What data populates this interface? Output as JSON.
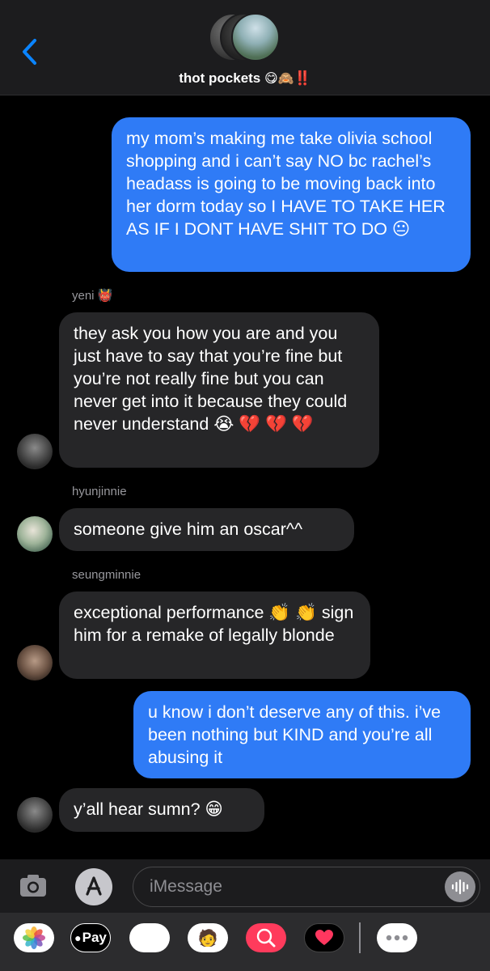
{
  "header": {
    "title": "thot pockets",
    "title_emojis": "😋🙈",
    "title_bang": "‼️"
  },
  "messages": [
    {
      "id": 1,
      "direction": "outgoing",
      "text": "my mom’s making me take olivia school shopping and i can’t say NO bc rachel’s headass is going to be moving back into her dorm today so I HAVE TO TAKE HER AS IF I DONT HAVE SHIT TO DO 😐"
    },
    {
      "id": 2,
      "direction": "incoming",
      "sender": "yeni 👹",
      "text": "they ask you how you are and you just have to say that you’re fine but you’re not really fine but you can never get into it because they could never understand 😭 💔 💔 💔"
    },
    {
      "id": 3,
      "direction": "incoming",
      "sender": "hyunjinnie",
      "text": "someone give him an oscar^^"
    },
    {
      "id": 4,
      "direction": "incoming",
      "sender": "seungminnie",
      "text": "exceptional performance 👏 👏 sign him for a remake of legally blonde"
    },
    {
      "id": 5,
      "direction": "outgoing",
      "text": "u know i don’t deserve any of this. i’ve been nothing but KIND and you’re all abusing it"
    },
    {
      "id": 6,
      "direction": "incoming",
      "text": "y’all hear sumn? 😁"
    }
  ],
  "composer": {
    "placeholder": "iMessage"
  },
  "tray": {
    "apple_pay_label": "Pay",
    "apps": [
      "photos-icon",
      "apple-pay-icon",
      "animoji-icon",
      "memoji-icon",
      "gif-search-icon",
      "digital-touch-icon",
      "more-icon"
    ]
  },
  "colors": {
    "outgoing_bubble": "#2f7bf6",
    "incoming_bubble": "#262628",
    "background": "#000000",
    "header": "#1c1c1e",
    "accent": "#0a84ff"
  }
}
